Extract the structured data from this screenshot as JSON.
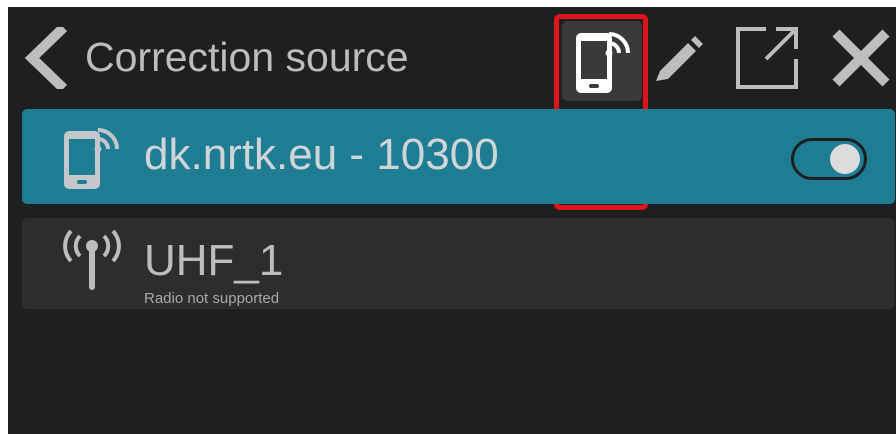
{
  "header": {
    "title": "Correction source",
    "back_icon": "chevron-left-icon",
    "edit_icon": "pencil-icon",
    "open_icon": "open-external-icon",
    "close_icon": "close-icon"
  },
  "source_type_buttons": [
    {
      "icon": "phone-wifi-icon"
    },
    {
      "icon": "radio-antenna-icon"
    }
  ],
  "sources": [
    {
      "icon": "phone-wifi-icon",
      "label": "dk.nrtk.eu - 10300",
      "subtitle": "",
      "selected": true,
      "enabled": true
    },
    {
      "icon": "radio-antenna-icon",
      "label": "UHF_1",
      "subtitle": "Radio not supported",
      "selected": false
    }
  ],
  "colors": {
    "background": "#1e1f21",
    "selected_row": "#1f7d93",
    "row": "#2c2d2f",
    "highlight": "#e0141c",
    "text": "#bdbdbd"
  }
}
